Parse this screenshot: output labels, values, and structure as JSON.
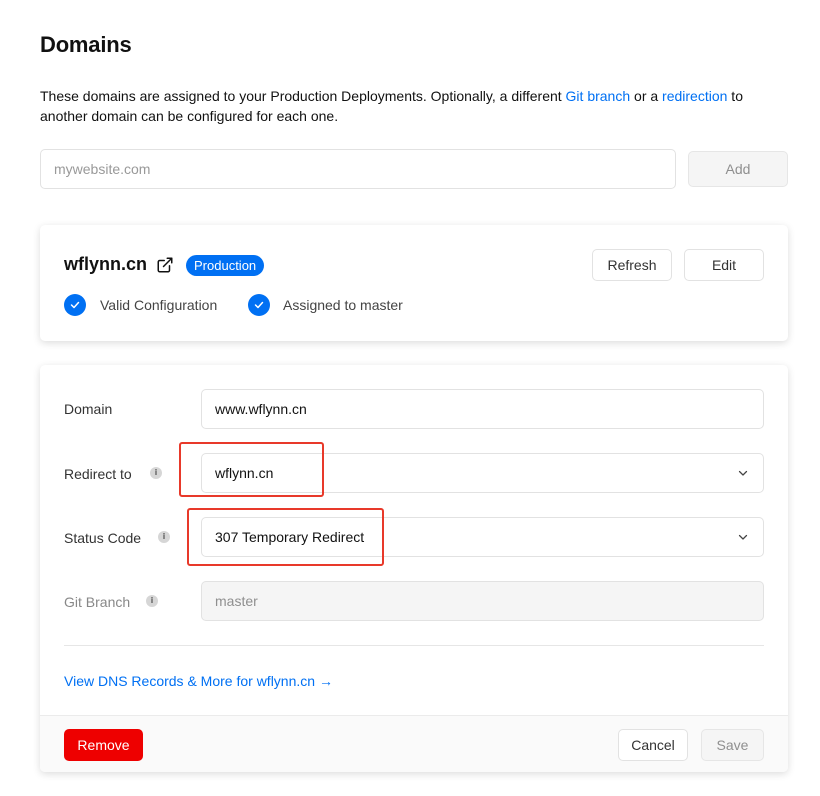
{
  "page": {
    "title": "Domains",
    "description_before_git": "These domains are assigned to your Production Deployments. Optionally, a different ",
    "git_branch_link": "Git branch",
    "description_or": " or a ",
    "redirection_link": "redirection",
    "description_after": " to another domain can be configured for each one."
  },
  "add_domain": {
    "placeholder": "mywebsite.com",
    "button_label": "Add"
  },
  "domain_card": {
    "name": "wflynn.cn",
    "badge": "Production",
    "refresh_label": "Refresh",
    "edit_label": "Edit",
    "checks": [
      {
        "label": "Valid Configuration"
      },
      {
        "label": "Assigned to master"
      }
    ]
  },
  "edit_form": {
    "domain_label": "Domain",
    "domain_value": "www.wflynn.cn",
    "redirect_label": "Redirect to",
    "redirect_value": "wflynn.cn",
    "status_label": "Status Code",
    "status_value": "307 Temporary Redirect",
    "branch_label": "Git Branch",
    "branch_value": "master",
    "dns_link": "View DNS Records & More for wflynn.cn →",
    "remove_label": "Remove",
    "cancel_label": "Cancel",
    "save_label": "Save"
  },
  "icons": {
    "info": "i",
    "external_link": "external-link-icon",
    "check": "check-icon",
    "chevron": "chevron-down-icon"
  },
  "colors": {
    "accent": "#0070f3",
    "danger": "#ee0000",
    "highlight": "#e8392a"
  }
}
